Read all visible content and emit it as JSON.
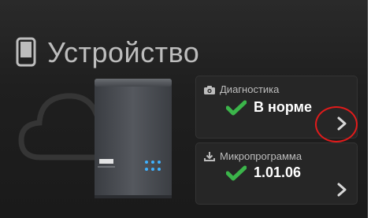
{
  "header": {
    "title": "Устройство",
    "icon": "device-icon"
  },
  "cards": {
    "diagnostics": {
      "label": "Диагностика",
      "icon": "camera-icon",
      "status": "В норме",
      "status_icon": "check-icon"
    },
    "firmware": {
      "label": "Микропрограмма",
      "icon": "download-icon",
      "version": "1.01.06",
      "status_icon": "check-icon"
    }
  },
  "colors": {
    "background": "#1f1f1f",
    "card_background": "#262626",
    "check_green": "#3bb54a",
    "highlight_red": "#e11b1b",
    "text_muted": "#bdbdbd"
  }
}
